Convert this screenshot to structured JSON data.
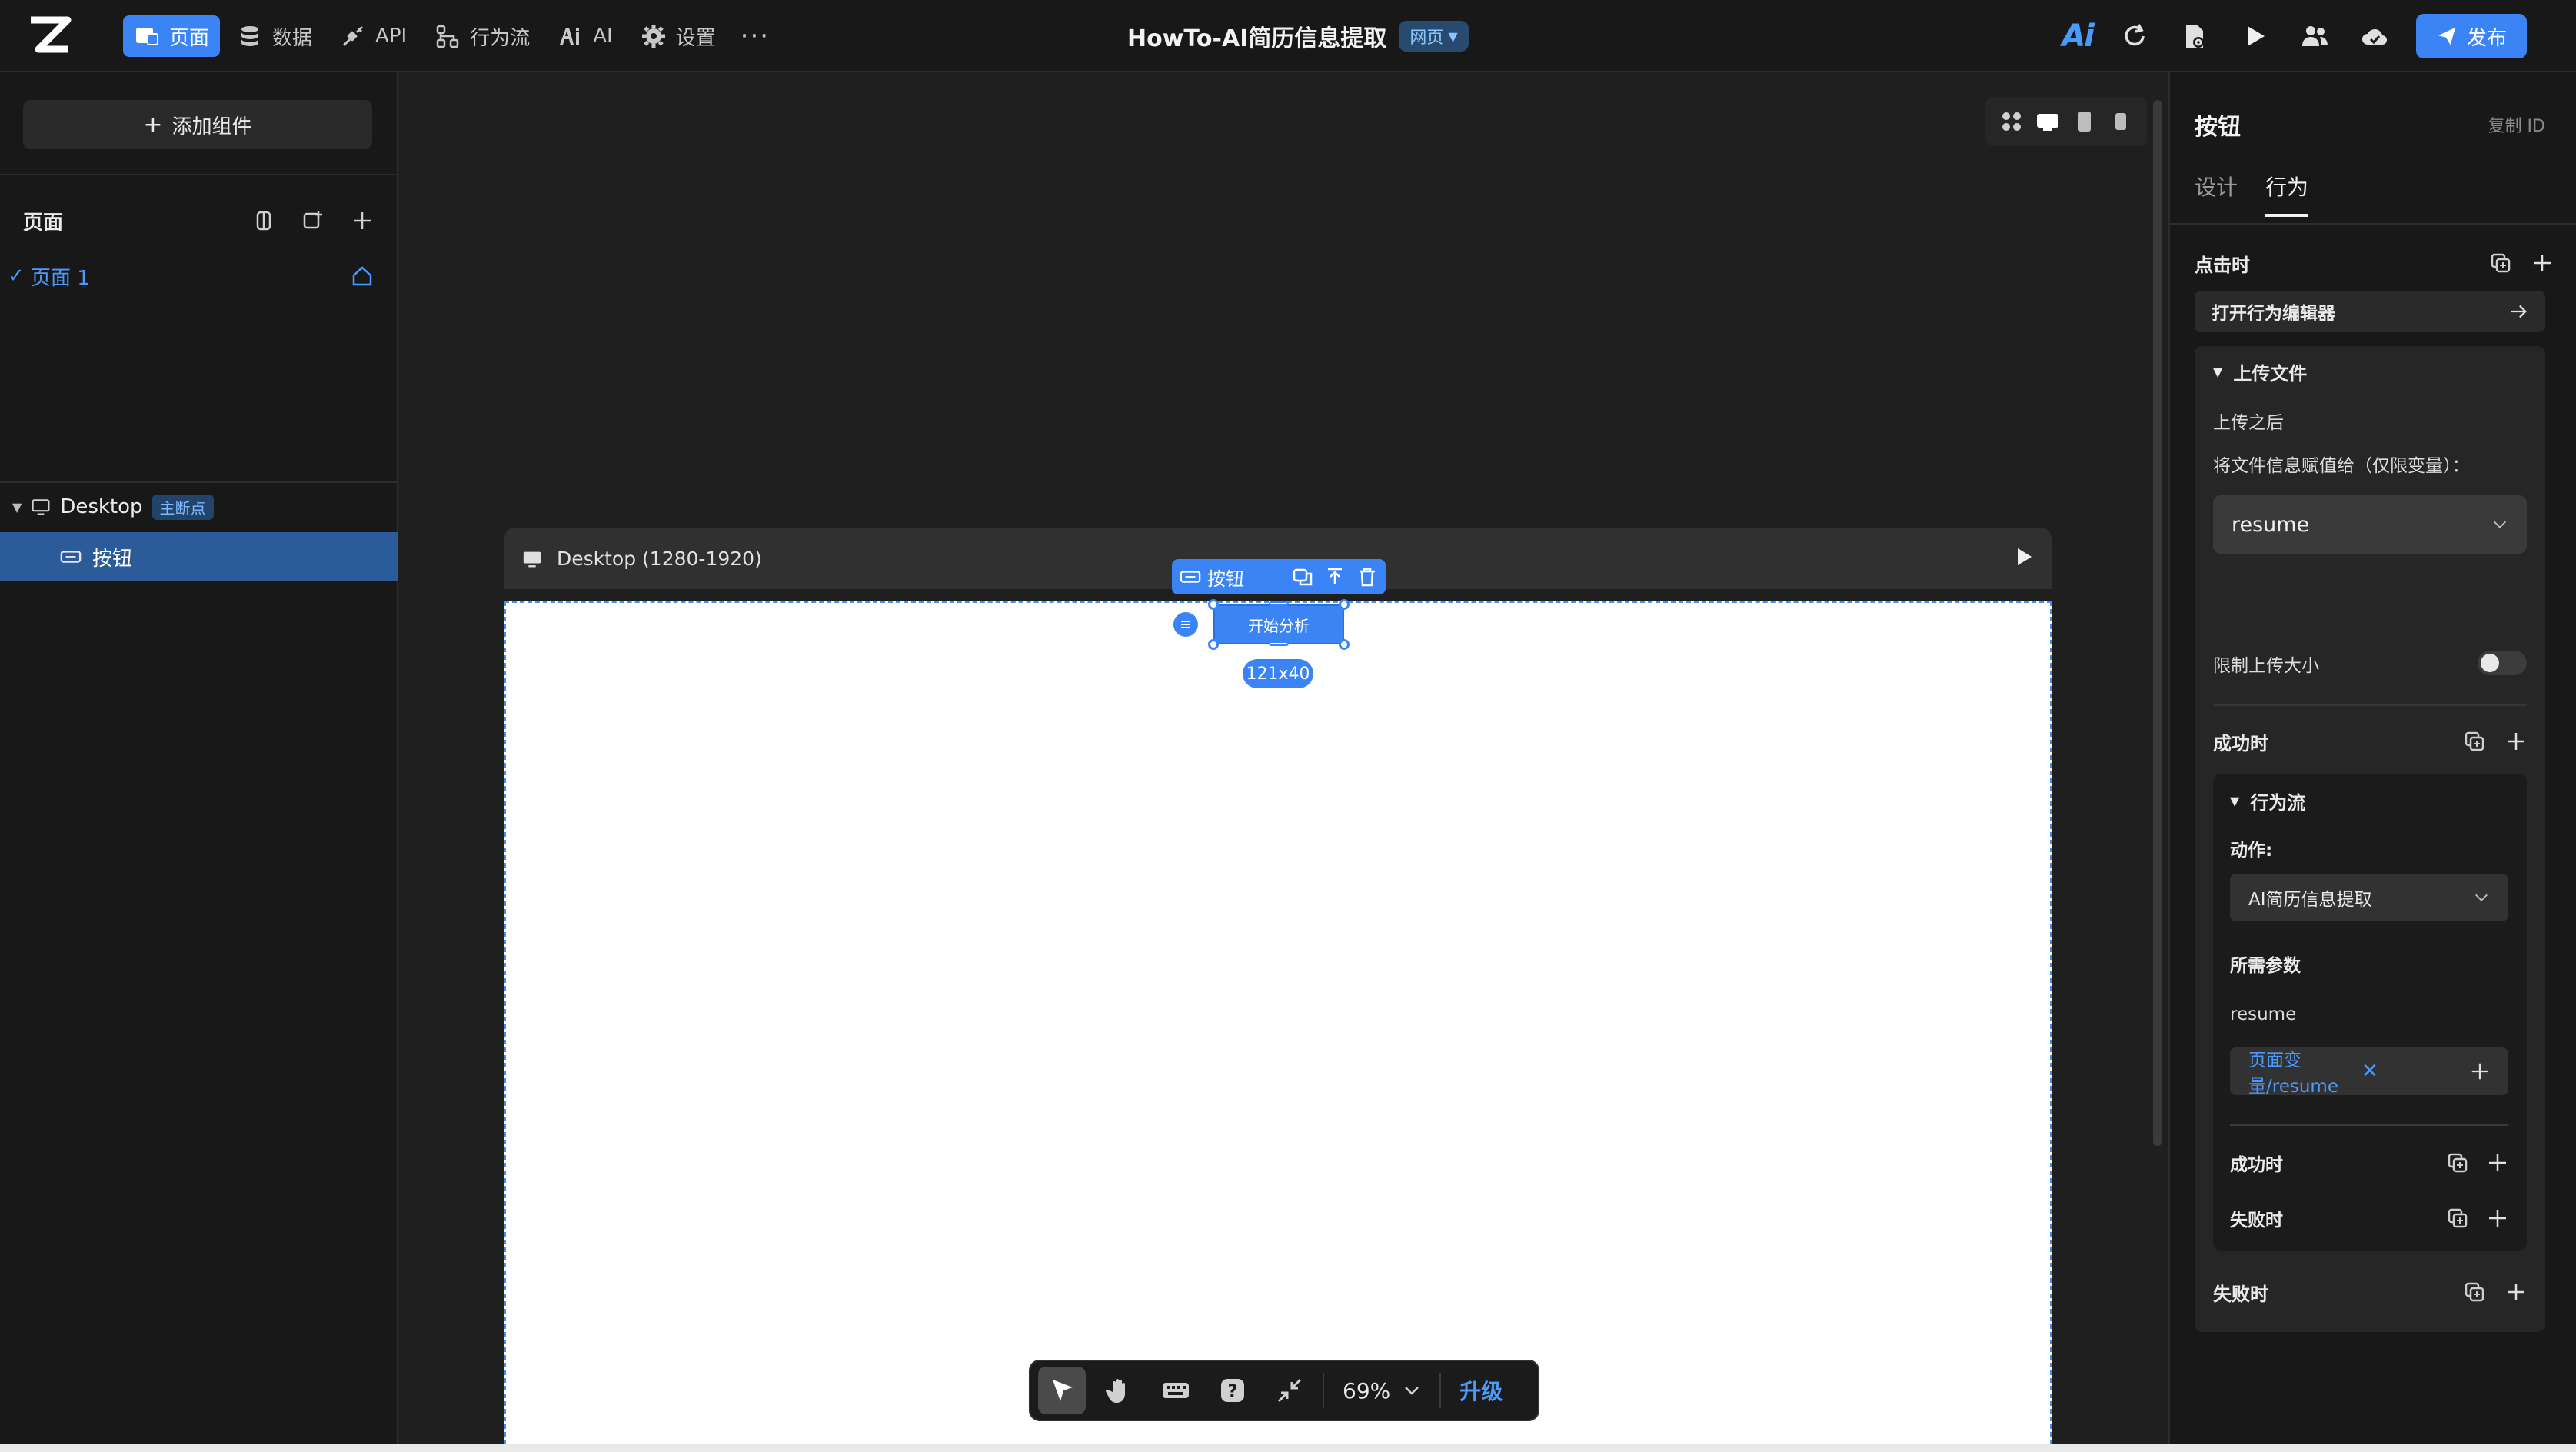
{
  "topbar": {
    "nav": [
      {
        "label": "页面",
        "icon": "page-icon",
        "active": true
      },
      {
        "label": "数据",
        "icon": "database-icon",
        "active": false
      },
      {
        "label": "API",
        "icon": "api-icon",
        "active": false
      },
      {
        "label": "行为流",
        "icon": "flow-icon",
        "active": false
      },
      {
        "label": "AI",
        "icon": "ai-icon",
        "active": false
      },
      {
        "label": "设置",
        "icon": "gear-icon",
        "active": false
      }
    ],
    "more": "···",
    "app_title": "HowTo-AI简历信息提取",
    "page_type": "网页",
    "ai_logo": "Ai",
    "publish_label": "发布"
  },
  "left_panel": {
    "add_component": "添加组件",
    "pages_label": "页面",
    "pages": [
      {
        "name": "页面 1",
        "selected": true
      }
    ],
    "layers": {
      "desktop_label": "Desktop",
      "desktop_badge": "主断点",
      "selected_layer": "按钮"
    }
  },
  "canvas": {
    "frame_title": "Desktop (1280-1920)",
    "selection_label": "按钮",
    "button_text": "开始分析",
    "size_label": "121x40",
    "zoom": "69%",
    "upgrade": "升级"
  },
  "right_panel": {
    "title": "按钮",
    "copy_id": "复制 ID",
    "tabs": [
      {
        "label": "设计",
        "active": false
      },
      {
        "label": "行为",
        "active": true
      }
    ],
    "on_click": "点击时",
    "open_editor": "打开行为编辑器",
    "upload": {
      "header": "上传文件",
      "after_upload": "上传之后",
      "assign_label": "将文件信息赋值给（仅限变量）：",
      "variable": "resume",
      "limit_size": "限制上传大小",
      "on_success": "成功时"
    },
    "flow": {
      "header": "行为流",
      "action_label": "动作:",
      "action_value": "AI简历信息提取",
      "params_label": "所需参数",
      "param_name": "resume",
      "param_value": "页面变量/resume",
      "on_success": "成功时",
      "on_fail": "失败时"
    },
    "on_fail": "失败时"
  },
  "colors": {
    "accent": "#3a84f6",
    "bg_dark": "#181818",
    "canvas_bg": "#1f1f1f"
  }
}
